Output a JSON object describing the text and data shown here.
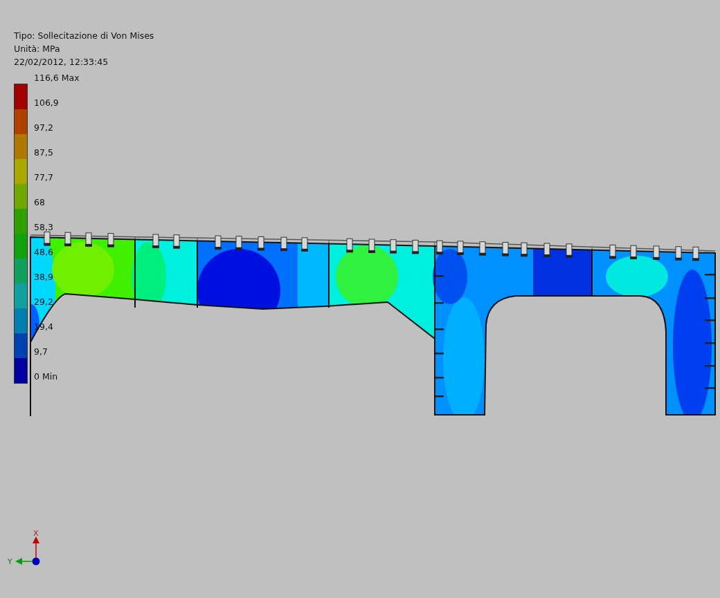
{
  "info": {
    "type": "Tipo: Sollecitazione di Von Mises",
    "unit": "Unità: MPa",
    "timestamp": "22/02/2012, 12:33:45"
  },
  "legend": {
    "labels": [
      "116,6 Max",
      "106,9",
      "97,2",
      "87,5",
      "77,7",
      "68",
      "58,3",
      "48,6",
      "38,9",
      "29,2",
      "19,4",
      "9,7",
      "0 Min"
    ],
    "bands": [
      {
        "color": "#a00000"
      },
      {
        "color": "#b04000"
      },
      {
        "color": "#b07800"
      },
      {
        "color": "#a8a800"
      },
      {
        "color": "#70a800"
      },
      {
        "color": "#30a000"
      },
      {
        "color": "#10a010"
      },
      {
        "color": "#10a060"
      },
      {
        "color": "#10a0a0"
      },
      {
        "color": "#0080b0"
      },
      {
        "color": "#0040b0"
      },
      {
        "color": "#0000a0"
      }
    ]
  },
  "axes": {
    "x_label": "X",
    "y_label": "Y"
  }
}
